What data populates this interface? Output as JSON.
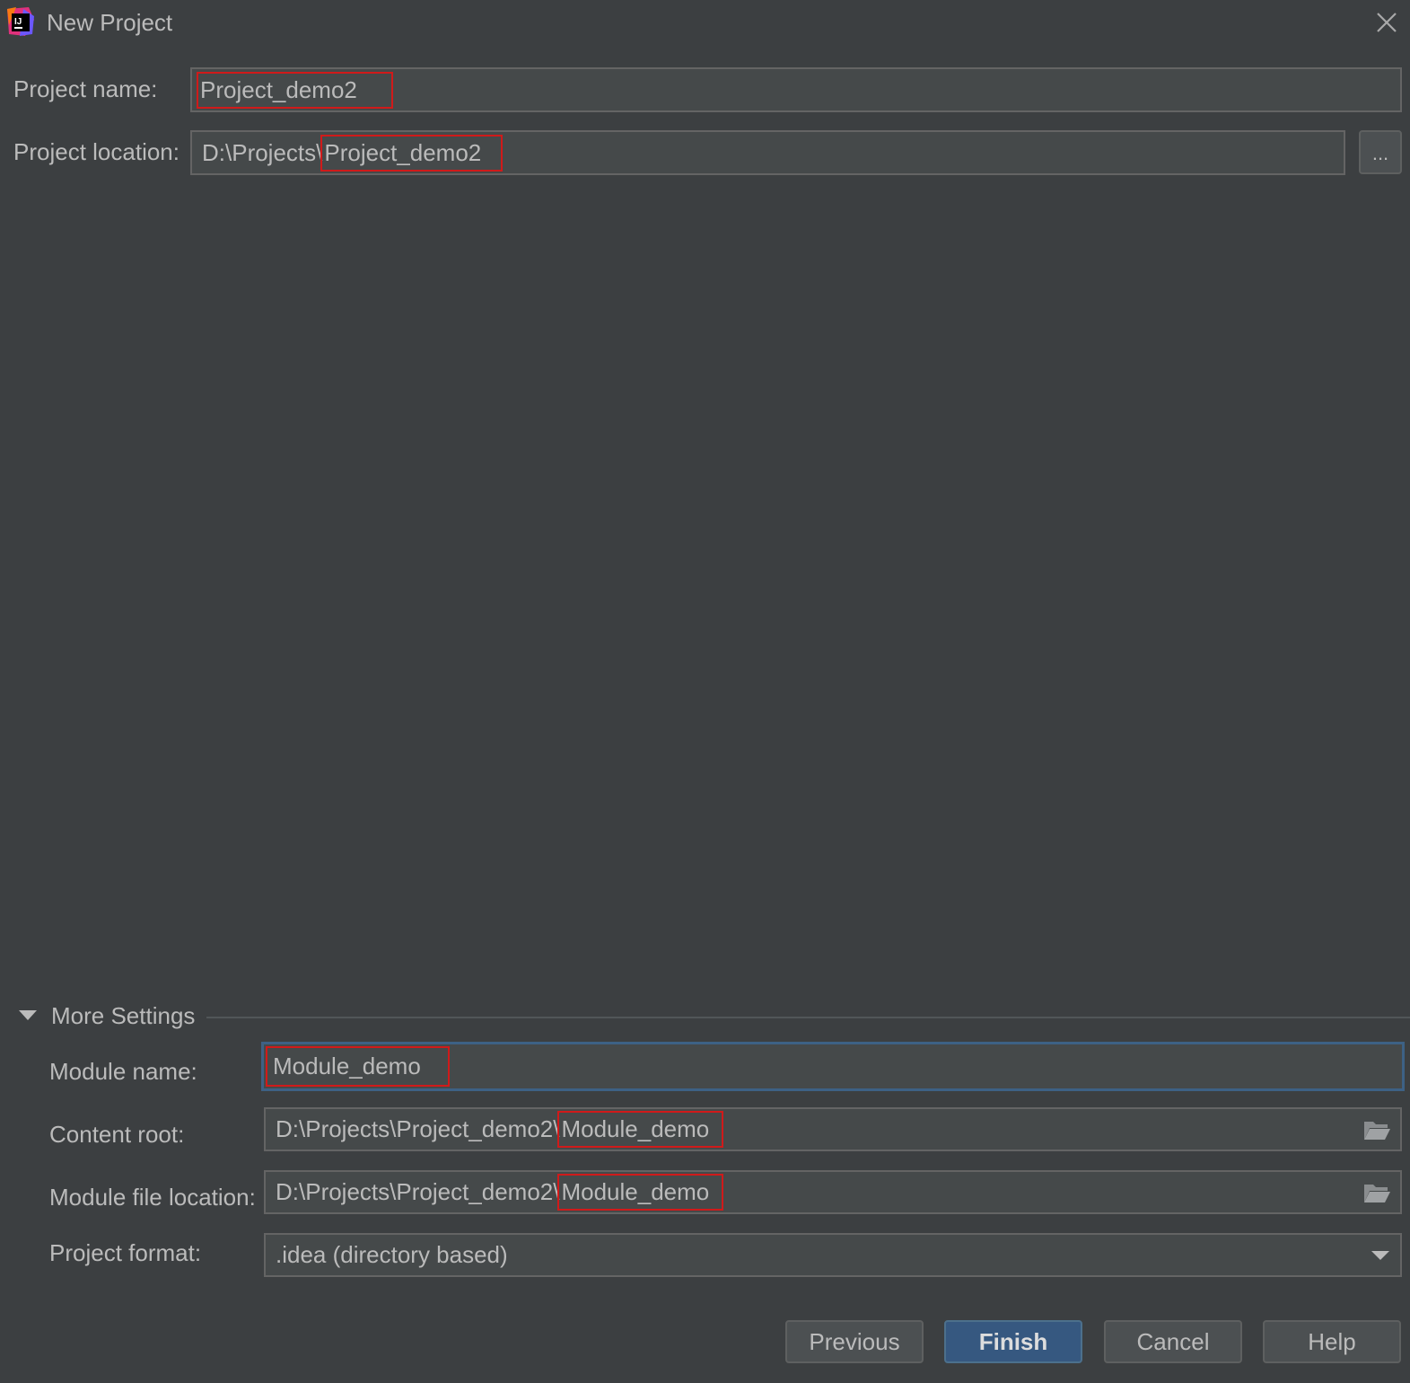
{
  "window": {
    "title": "New Project"
  },
  "form": {
    "project_name_label": "Project name:",
    "project_name_value": "Project_demo2",
    "project_location_label": "Project location:",
    "project_location_prefix": "D:\\Projects\\",
    "project_location_suffix": "Project_demo2",
    "browse_label": "..."
  },
  "more_settings": {
    "title": "More Settings",
    "module_name_label": "Module name:",
    "module_name_value": "Module_demo",
    "content_root_label": "Content root:",
    "content_root_prefix": "D:\\Projects\\Project_demo2\\",
    "content_root_suffix": "Module_demo",
    "module_file_location_label": "Module file location:",
    "module_file_location_prefix": "D:\\Projects\\Project_demo2\\",
    "module_file_location_suffix": "Module_demo",
    "project_format_label": "Project format:",
    "project_format_value": ".idea (directory based)"
  },
  "buttons": {
    "previous": "Previous",
    "finish": "Finish",
    "cancel": "Cancel",
    "help": "Help"
  },
  "colors": {
    "background": "#3c3f41",
    "field_background": "#45494a",
    "primary_button": "#365880",
    "highlight_box": "#d01a1a"
  },
  "icons": [
    "intellij-app-icon",
    "close-icon",
    "folder-icon",
    "chevron-down-icon",
    "triangle-down-icon"
  ]
}
